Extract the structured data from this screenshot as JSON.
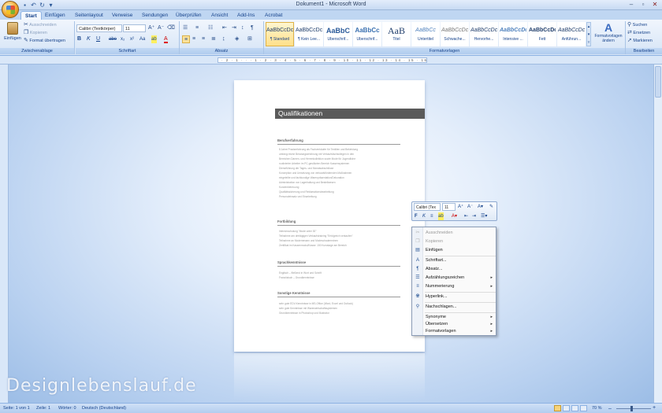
{
  "app": {
    "title": "Dokument1 - Microsoft Word"
  },
  "tabs": [
    "Start",
    "Einfügen",
    "Seitenlayout",
    "Verweise",
    "Sendungen",
    "Überprüfen",
    "Ansicht",
    "Add-Ins",
    "Acrobat"
  ],
  "clipboard": {
    "paste": "Einfügen",
    "cut": "Ausschneiden",
    "copy": "Kopieren",
    "format_painter": "Format übertragen",
    "label": "Zwischenablage"
  },
  "font": {
    "name": "Calibri (Textkörper)",
    "size": "11",
    "label": "Schriftart"
  },
  "paragraph": {
    "label": "Absatz"
  },
  "styles": {
    "items": [
      {
        "sample": "AaBbCcDc",
        "name": "¶ Standard"
      },
      {
        "sample": "AaBbCcDc",
        "name": "¶ Kein Lee..."
      },
      {
        "sample": "AaBbC",
        "name": "Überschrif..."
      },
      {
        "sample": "AaBbCc",
        "name": "Überschrif..."
      },
      {
        "sample": "AaB",
        "name": "Titel"
      },
      {
        "sample": "AaBbCc",
        "name": "Untertitel"
      },
      {
        "sample": "AaBbCcDc",
        "name": "Schwache..."
      },
      {
        "sample": "AaBbCcDc",
        "name": "Hervorhe..."
      },
      {
        "sample": "AaBbCcDc",
        "name": "Intensive ..."
      },
      {
        "sample": "AaBbCcDc",
        "name": "Fett"
      },
      {
        "sample": "AaBbCcDc",
        "name": "Anführun..."
      }
    ],
    "change": "Formatvorlagen ändern",
    "label": "Formatvorlagen"
  },
  "editing": {
    "find": "Suchen",
    "replace": "Ersetzen",
    "select": "Markieren",
    "label": "Bearbeiten"
  },
  "ruler_text": "· 2 · 1 · · · 1 · 2 · 3 · 4 · 5 · 6 · 7 · 8 · 9 · 10 · 11 · 12 · 13 · 14 · 15 · 16 · 17 · 18 ·",
  "document": {
    "heading": "Qualifikationen",
    "sections": [
      {
        "title": "Berufserfahrung",
        "bullets": [
          "8 Jahre Praxiserfahrung als Fachverkäufer für Textilien und Bekleidung",
          "umfang reiche Beratungserfahrung mit Verkaufsfachkollegen in den",
          "Bereichen Damen- und Herrenkollektion sowie Mode für Jugendliche",
          "routinierter Arbeiter im PC-gestützten Bereich Kassensystemen",
          "Dienstführung der Tages- und Monatsabschlüsse",
          "Konzeption und Umsetzung von verkaufsfördernden Maßnahmen",
          "eingeteilte und fachkundige Warenpräsentation/Dekoration",
          "Administration von Lagerhaltung und Bestellwesen",
          "Kundenbetreuung",
          "Qualitätssicherung und Reklamationsbearbeitung",
          "Personaleinsatz und Einarbeitung"
        ]
      },
      {
        "title": "Fortbildung",
        "bullets": [
          "Intensivschulung \"Mode unter 30\"",
          "Teilnahme am dreitägigen Verkaufstraining \"Erfolgreich verkaufen\"",
          "Teilnahme an Modemessen und Modeschauterminen",
          "Zertifikat im Kassenmodul/Kasse: 150 Kursstage am Bereich"
        ]
      },
      {
        "title": "Sprachkenntnisse",
        "bullets": [
          "Englisch – fließend in Wort und Schrift",
          "Französisch – Grundkenntnisse"
        ]
      },
      {
        "title": "Sonstige Kenntnisse",
        "bullets": [
          "sehr gute EDV-Kenntnisse in MS-Office (Word, Excel und Outlook)",
          "sehr gute Kenntnisse mit Warenwirtschaftssystemen",
          "Grundkenntnisse in Photoshop und Illustrator"
        ]
      }
    ]
  },
  "minibar": {
    "font": "Calibri (Tex",
    "size": "11"
  },
  "context_menu": [
    {
      "label": "Ausschneiden",
      "icon": "cut-icon",
      "disabled": true,
      "submenu": false
    },
    {
      "label": "Kopieren",
      "icon": "copy-icon",
      "disabled": true,
      "submenu": false
    },
    {
      "label": "Einfügen",
      "icon": "paste-icon",
      "disabled": false,
      "submenu": false
    },
    {
      "label": "Schriftart...",
      "icon": "font-icon",
      "disabled": false,
      "submenu": false
    },
    {
      "label": "Absatz...",
      "icon": "paragraph-icon",
      "disabled": false,
      "submenu": false
    },
    {
      "label": "Aufzählungszeichen",
      "icon": "bullets-icon",
      "disabled": false,
      "submenu": true
    },
    {
      "label": "Nummerierung",
      "icon": "numbering-icon",
      "disabled": false,
      "submenu": true
    },
    {
      "label": "Hyperlink...",
      "icon": "hyperlink-icon",
      "disabled": false,
      "submenu": false
    },
    {
      "label": "Nachschlagen...",
      "icon": "lookup-icon",
      "disabled": false,
      "submenu": false
    },
    {
      "label": "Synonyme",
      "icon": "",
      "disabled": false,
      "submenu": true
    },
    {
      "label": "Übersetzen",
      "icon": "",
      "disabled": false,
      "submenu": true
    },
    {
      "label": "Formatvorlagen",
      "icon": "",
      "disabled": false,
      "submenu": true
    }
  ],
  "status": {
    "page": "Seite: 1 von 1",
    "line": "Zeile: 1",
    "words": "Wörter: 0",
    "language": "Deutsch (Deutschland)",
    "zoom": "70 %"
  },
  "watermark": "Designlebenslauf.de"
}
